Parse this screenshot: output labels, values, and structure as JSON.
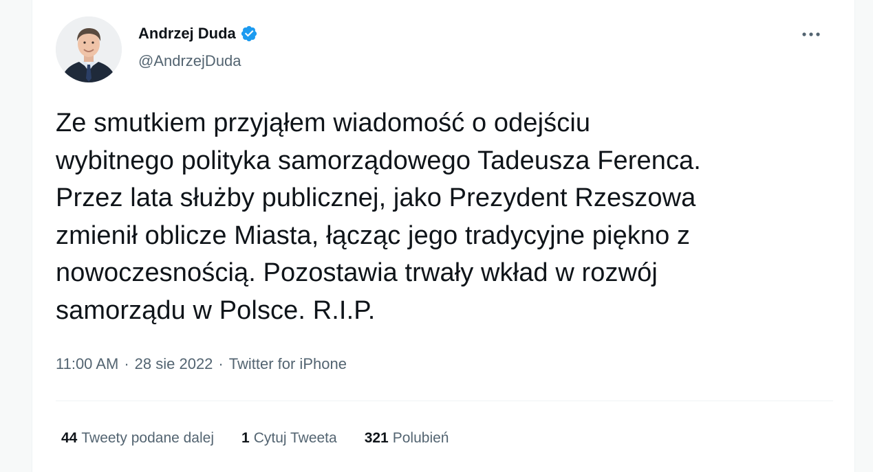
{
  "author": {
    "display_name": "Andrzej Duda",
    "handle": "@AndrzejDuda",
    "verified": true,
    "avatar_icon": "profile-photo"
  },
  "tweet": {
    "text_lines": [
      "Ze smutkiem przyjąłem wiadomość o odejściu",
      "wybitnego polityka samorządowego Tadeusza Ferenca.",
      "Przez lata służby publicznej, jako Prezydent Rzeszowa",
      "zmienił oblicze Miasta, łącząc jego tradycyjne piękno z",
      "nowoczesnością. Pozostawia trwały wkład w rozwój",
      "samorządu w Polsce. R.I.P."
    ],
    "time": "11:00 AM",
    "separator": "·",
    "date": "28 sie 2022",
    "source": "Twitter for iPhone"
  },
  "stats": {
    "retweets": {
      "count": "44",
      "label": "Tweety podane dalej"
    },
    "quotes": {
      "count": "1",
      "label": "Cytuj Tweeta"
    },
    "likes": {
      "count": "321",
      "label": "Polubień"
    }
  },
  "menu": {
    "more_icon": "more-horizontal-icon"
  },
  "colors": {
    "text_primary": "#0f1419",
    "text_secondary": "#536471",
    "verified_blue": "#1d9bf0",
    "divider": "#eff3f4"
  }
}
